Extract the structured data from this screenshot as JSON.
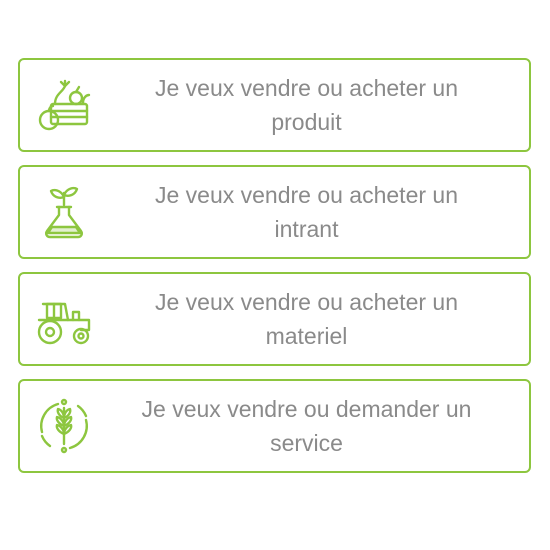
{
  "accent_color": "#8dc63f",
  "text_color": "#8a8a8a",
  "options": [
    {
      "icon": "produce-basket-icon",
      "line1": "Je veux vendre ou acheter un",
      "line2": "produit"
    },
    {
      "icon": "sprout-flask-icon",
      "line1": "Je veux vendre ou acheter un",
      "line2": "intrant"
    },
    {
      "icon": "tractor-icon",
      "line1": "Je veux vendre ou acheter un",
      "line2": "materiel"
    },
    {
      "icon": "wheat-circle-icon",
      "line1": "Je veux vendre ou demander un",
      "line2": "service"
    }
  ]
}
